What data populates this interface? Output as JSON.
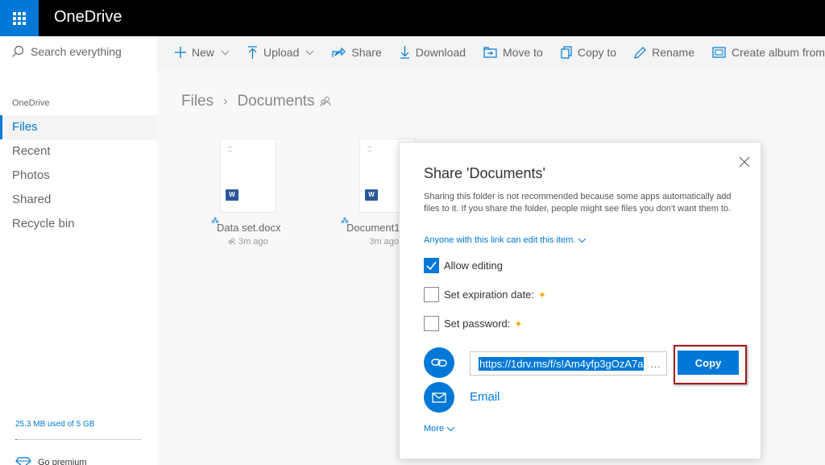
{
  "app": {
    "title": "OneDrive"
  },
  "search": {
    "placeholder": "Search everything"
  },
  "sidebar": {
    "section": "OneDrive",
    "items": [
      {
        "label": "Files",
        "active": true
      },
      {
        "label": "Recent"
      },
      {
        "label": "Photos"
      },
      {
        "label": "Shared"
      },
      {
        "label": "Recycle bin"
      }
    ],
    "storage_text": "25.3 MB used of 5 GB",
    "storage_used_fraction": 0.005,
    "premium_label": "Go premium"
  },
  "toolbar": {
    "new_label": "New",
    "upload_label": "Upload",
    "share_label": "Share",
    "download_label": "Download",
    "moveto_label": "Move to",
    "copyto_label": "Copy to",
    "rename_label": "Rename",
    "album_label": "Create album from folder"
  },
  "breadcrumb": {
    "root": "Files",
    "current": "Documents"
  },
  "files": [
    {
      "name": "Data set.docx",
      "time": "3m ago"
    },
    {
      "name": "Document1",
      "time": "3m ago"
    }
  ],
  "dialog": {
    "title": "Share 'Documents'",
    "description": "Sharing this folder is not recommended because some apps automatically add files to it. If you share the folder, people might see files you don't want them to.",
    "permission_link": "Anyone with this link can edit this item.",
    "allow_editing": {
      "label": "Allow editing",
      "checked": true
    },
    "expiration": {
      "label": "Set expiration date:",
      "checked": false
    },
    "password": {
      "label": "Set password:",
      "checked": false
    },
    "link_value": "https://1drv.ms/f/s!Am4yfp3gOzA7a",
    "copy_label": "Copy",
    "email_label": "Email",
    "more_label": "More"
  },
  "colors": {
    "accent": "#0078d7",
    "topbar": "#000000",
    "premium_star": "#f2a900",
    "highlight": "#a3161c"
  }
}
